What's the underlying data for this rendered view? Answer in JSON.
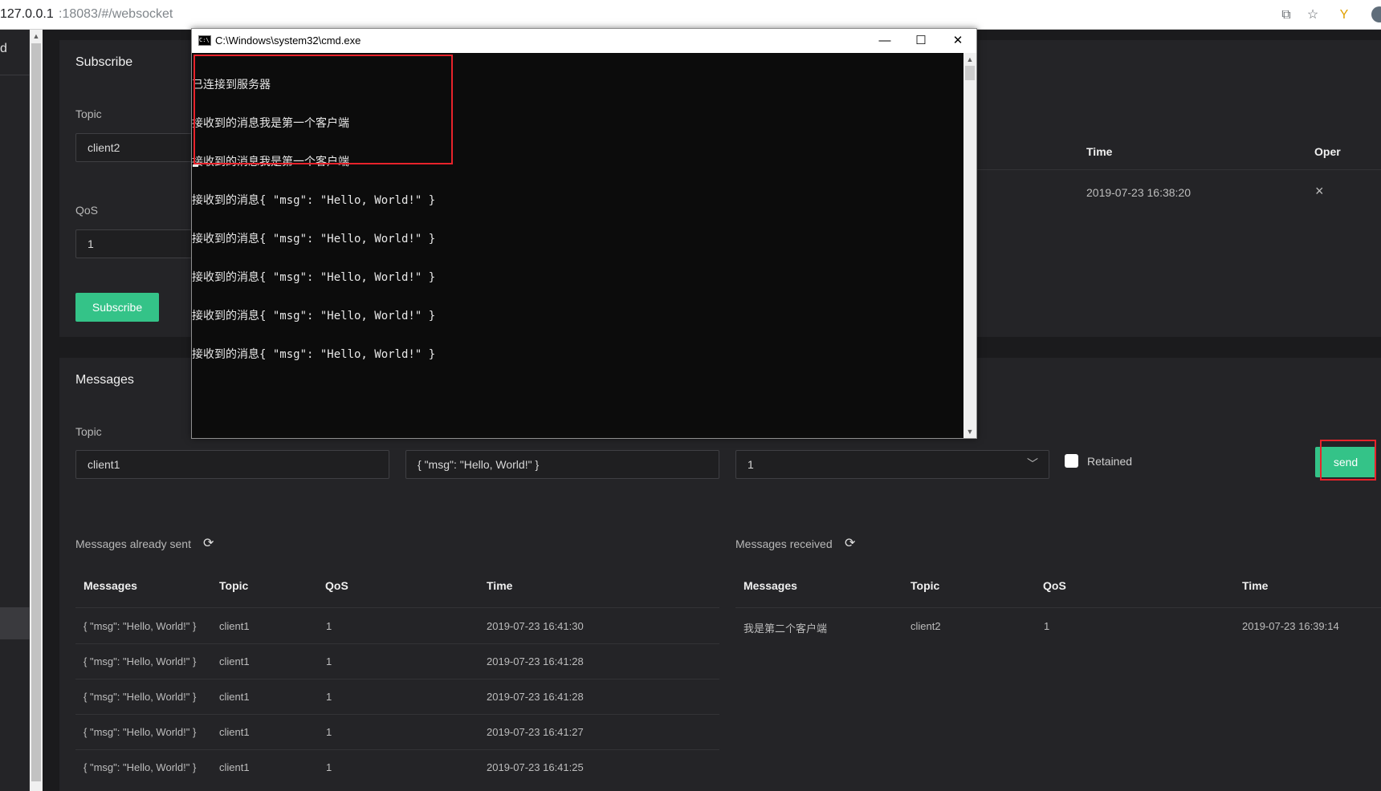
{
  "browser": {
    "url_host": "127.0.0.1",
    "url_rest": ":18083/#/websocket"
  },
  "nav": {
    "logo_fragment": "d"
  },
  "subscribe": {
    "title": "Subscribe",
    "topic_label": "Topic",
    "topic_value": "client2",
    "qos_label": "QoS",
    "qos_value": "1",
    "button": "Subscribe"
  },
  "subscriptions": {
    "headers": {
      "time": "Time",
      "oper": "Oper"
    },
    "row": {
      "time": "2019-07-23 16:38:20",
      "oper": "×"
    }
  },
  "messages": {
    "title": "Messages",
    "topic_label": "Topic",
    "topic_value": "client1",
    "payload_value": "{ \"msg\": \"Hello, World!\" }",
    "qos_value": "1",
    "retained_label": "Retained",
    "send_button": "send"
  },
  "sent": {
    "title": "Messages already sent",
    "headers": [
      "Messages",
      "Topic",
      "QoS",
      "Time"
    ],
    "rows": [
      [
        "{ \"msg\": \"Hello, World!\" }",
        "client1",
        "1",
        "2019-07-23 16:41:30"
      ],
      [
        "{ \"msg\": \"Hello, World!\" }",
        "client1",
        "1",
        "2019-07-23 16:41:28"
      ],
      [
        "{ \"msg\": \"Hello, World!\" }",
        "client1",
        "1",
        "2019-07-23 16:41:28"
      ],
      [
        "{ \"msg\": \"Hello, World!\" }",
        "client1",
        "1",
        "2019-07-23 16:41:27"
      ],
      [
        "{ \"msg\": \"Hello, World!\" }",
        "client1",
        "1",
        "2019-07-23 16:41:25"
      ]
    ]
  },
  "received": {
    "title": "Messages received",
    "headers": [
      "Messages",
      "Topic",
      "QoS",
      "Time"
    ],
    "rows": [
      [
        "我是第二个客户端",
        "client2",
        "1",
        "2019-07-23 16:39:14"
      ]
    ]
  },
  "cmd": {
    "title": "C:\\Windows\\system32\\cmd.exe",
    "icon_text": "C:\\",
    "lines": [
      "已连接到服务器",
      "接收到的消息我是第一个客户端",
      "接收到的消息我是第一个客户端",
      "接收到的消息{ \"msg\": \"Hello, World!\" }",
      "接收到的消息{ \"msg\": \"Hello, World!\" }",
      "接收到的消息{ \"msg\": \"Hello, World!\" }",
      "接收到的消息{ \"msg\": \"Hello, World!\" }",
      "接收到的消息{ \"msg\": \"Hello, World!\" }"
    ]
  },
  "colors": {
    "accent": "#34c388",
    "highlight": "#e8232b",
    "panel": "#242427",
    "background": "#1b1b1d"
  }
}
